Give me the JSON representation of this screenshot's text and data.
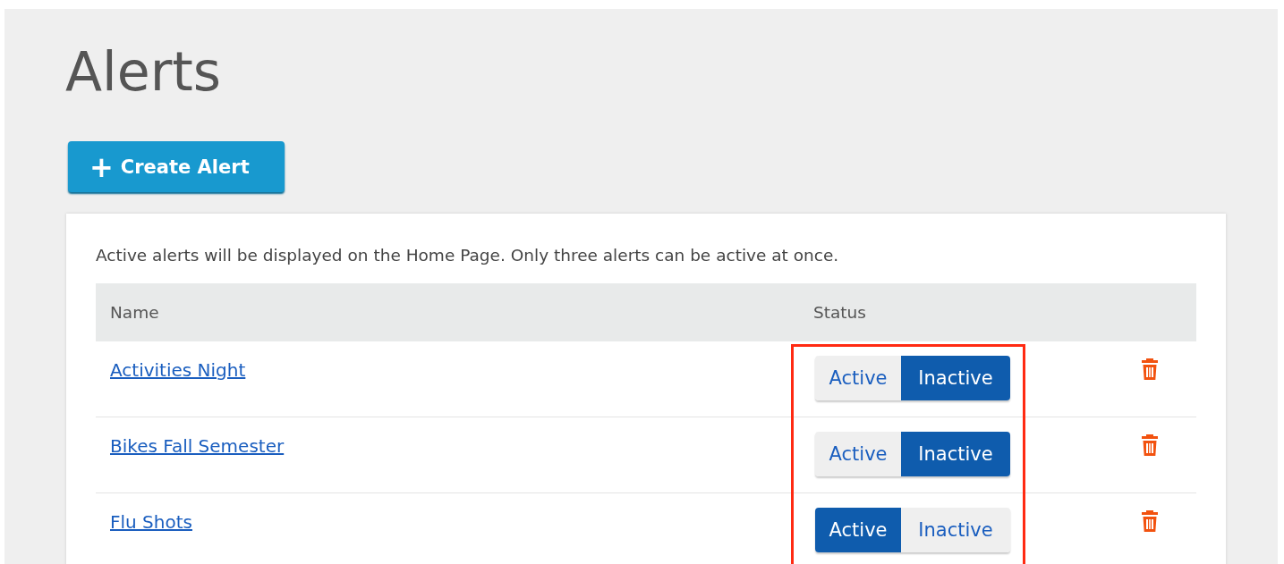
{
  "title": "Alerts",
  "create_button": {
    "icon": "+",
    "label": "Create Alert"
  },
  "description": "Active alerts will be displayed on the Home Page. Only three alerts can be active at once.",
  "table": {
    "columns": [
      "Name",
      "Status"
    ],
    "rows": [
      {
        "name": "Activities Night",
        "status": [
          {
            "label": "Active",
            "selected": false
          },
          {
            "label": "Inactive",
            "selected": true
          }
        ]
      },
      {
        "name": "Bikes Fall Semester",
        "status": [
          {
            "label": "Active",
            "selected": false
          },
          {
            "label": "Inactive",
            "selected": true
          }
        ]
      },
      {
        "name": "Flu Shots",
        "status": [
          {
            "label": "Active",
            "selected": true
          },
          {
            "label": "Inactive",
            "selected": false
          }
        ]
      }
    ]
  },
  "highlight": {
    "color": "#ff2a12"
  }
}
